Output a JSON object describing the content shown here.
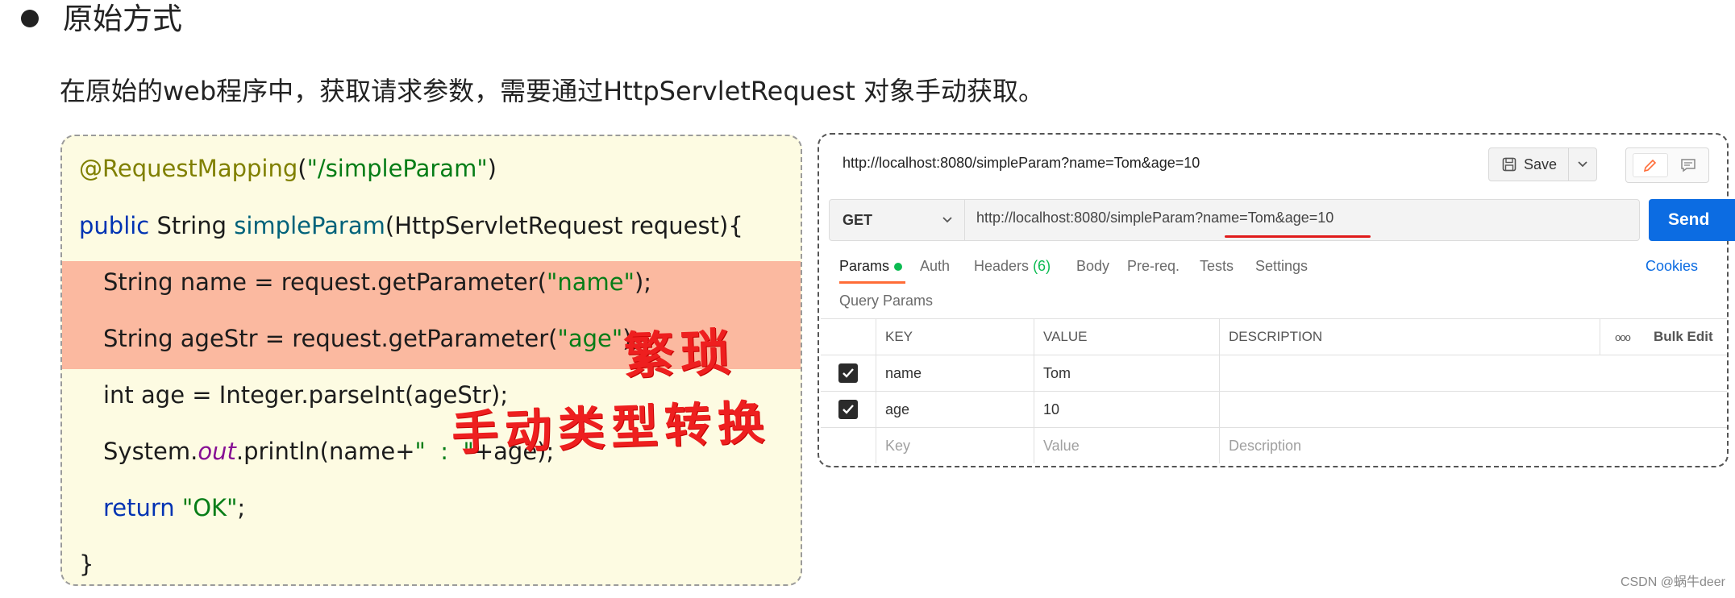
{
  "section": {
    "heading": "原始方式",
    "intro": "在原始的web程序中，获取请求参数，需要通过HttpServletRequest 对象手动获取。"
  },
  "code": {
    "l1_ann": "@RequestMapping",
    "l1_paren_open": "(",
    "l1_str": "\"/simpleParam\"",
    "l1_paren_close": ")",
    "l2_kw": "public",
    "l2_type": " String ",
    "l2_fn": "simpleParam",
    "l2_rest": "(HttpServletRequest request){",
    "l3_a": "String name = request.getParameter(",
    "l3_str": "\"name\"",
    "l3_b": ");",
    "l4_a": "String ageStr = request.getParameter(",
    "l4_str": "\"age\"",
    "l4_b": ");",
    "l5": "int age = Integer.parseInt(ageStr);",
    "l6_a": "System.",
    "l6_it": "out",
    "l6_b": ".println(name+",
    "l6_str": "\"  :  \"",
    "l6_c": "+age);",
    "l7_kw": "return",
    "l7_sp": " ",
    "l7_str": "\"OK\"",
    "l7_end": ";",
    "l8": "}"
  },
  "annotations": {
    "tedious": "繁琐",
    "manual_conversion": "手动类型转换"
  },
  "postman": {
    "request_title": "http://localhost:8080/simpleParam?name=Tom&age=10",
    "save_label": "Save",
    "method": "GET",
    "url_value": "http://localhost:8080/simpleParam?name=Tom&age=10",
    "send_label": "Send",
    "tabs": {
      "params": "Params",
      "auth": "Auth",
      "headers": "Headers",
      "headers_count": "(6)",
      "body": "Body",
      "prereq": "Pre-req.",
      "tests": "Tests",
      "settings": "Settings"
    },
    "cookies": "Cookies",
    "query_params_title": "Query Params",
    "table": {
      "headers": {
        "key": "KEY",
        "value": "VALUE",
        "description": "DESCRIPTION",
        "more": "ooo",
        "bulk_edit": "Bulk Edit"
      },
      "rows": [
        {
          "key": "name",
          "value": "Tom",
          "description": "",
          "checked": true
        },
        {
          "key": "age",
          "value": "10",
          "description": "",
          "checked": true
        }
      ],
      "placeholders": {
        "key": "Key",
        "value": "Value",
        "description": "Description"
      }
    },
    "colors": {
      "send": "#0c6ce2",
      "params_dot": "#0cbb52",
      "active_tab_underline": "#ff6c37",
      "annotation_red": "#ee1f1f"
    }
  },
  "watermark": "CSDN @蜗牛deer"
}
